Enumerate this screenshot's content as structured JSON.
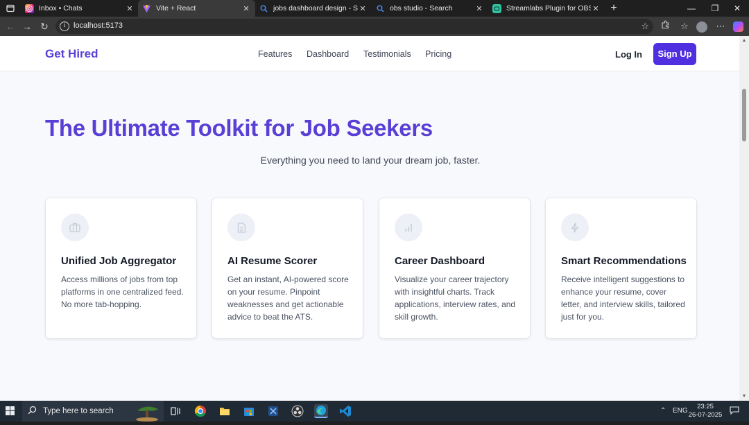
{
  "browser": {
    "tabs": [
      {
        "title": "Inbox • Chats",
        "favicon": "instagram-icon"
      },
      {
        "title": "Vite + React",
        "favicon": "vite-icon"
      },
      {
        "title": "jobs dashboard design - Search",
        "favicon": "search-icon"
      },
      {
        "title": "obs studio - Search",
        "favicon": "search-icon"
      },
      {
        "title": "Streamlabs Plugin for OBS | Add A",
        "favicon": "streamlabs-icon"
      }
    ],
    "new_tab": "+",
    "url": "localhost:5173",
    "controls": {
      "minimize": "—",
      "restore": "❐",
      "close": "✕"
    }
  },
  "site": {
    "logo": "Get Hired",
    "nav": [
      "Features",
      "Dashboard",
      "Testimonials",
      "Pricing"
    ],
    "login": "Log In",
    "signup": "Sign Up",
    "hero_title": "The Ultimate Toolkit for Job Seekers",
    "hero_subtitle": "Everything you need to land your dream job, faster.",
    "features": [
      {
        "icon": "briefcase-icon",
        "title": "Unified Job Aggregator",
        "description": "Access millions of jobs from top platforms in one centralized feed. No more tab-hopping."
      },
      {
        "icon": "document-icon",
        "title": "AI Resume Scorer",
        "description": "Get an instant, AI-powered score on your resume. Pinpoint weaknesses and get actionable advice to beat the ATS."
      },
      {
        "icon": "bar-chart-icon",
        "title": "Career Dashboard",
        "description": "Visualize your career trajectory with insightful charts. Track applications, interview rates, and skill growth."
      },
      {
        "icon": "lightning-icon",
        "title": "Smart Recommendations",
        "description": "Receive intelligent suggestions to enhance your resume, cover letter, and interview skills, tailored just for you."
      }
    ]
  },
  "taskbar": {
    "search_placeholder": "Type here to search",
    "language": "ENG",
    "time": "23:25",
    "date": "26-07-2025"
  },
  "colors": {
    "brand": "#5a3fd6",
    "button": "#4f2fe0",
    "page_bg": "#f8f9fc"
  }
}
